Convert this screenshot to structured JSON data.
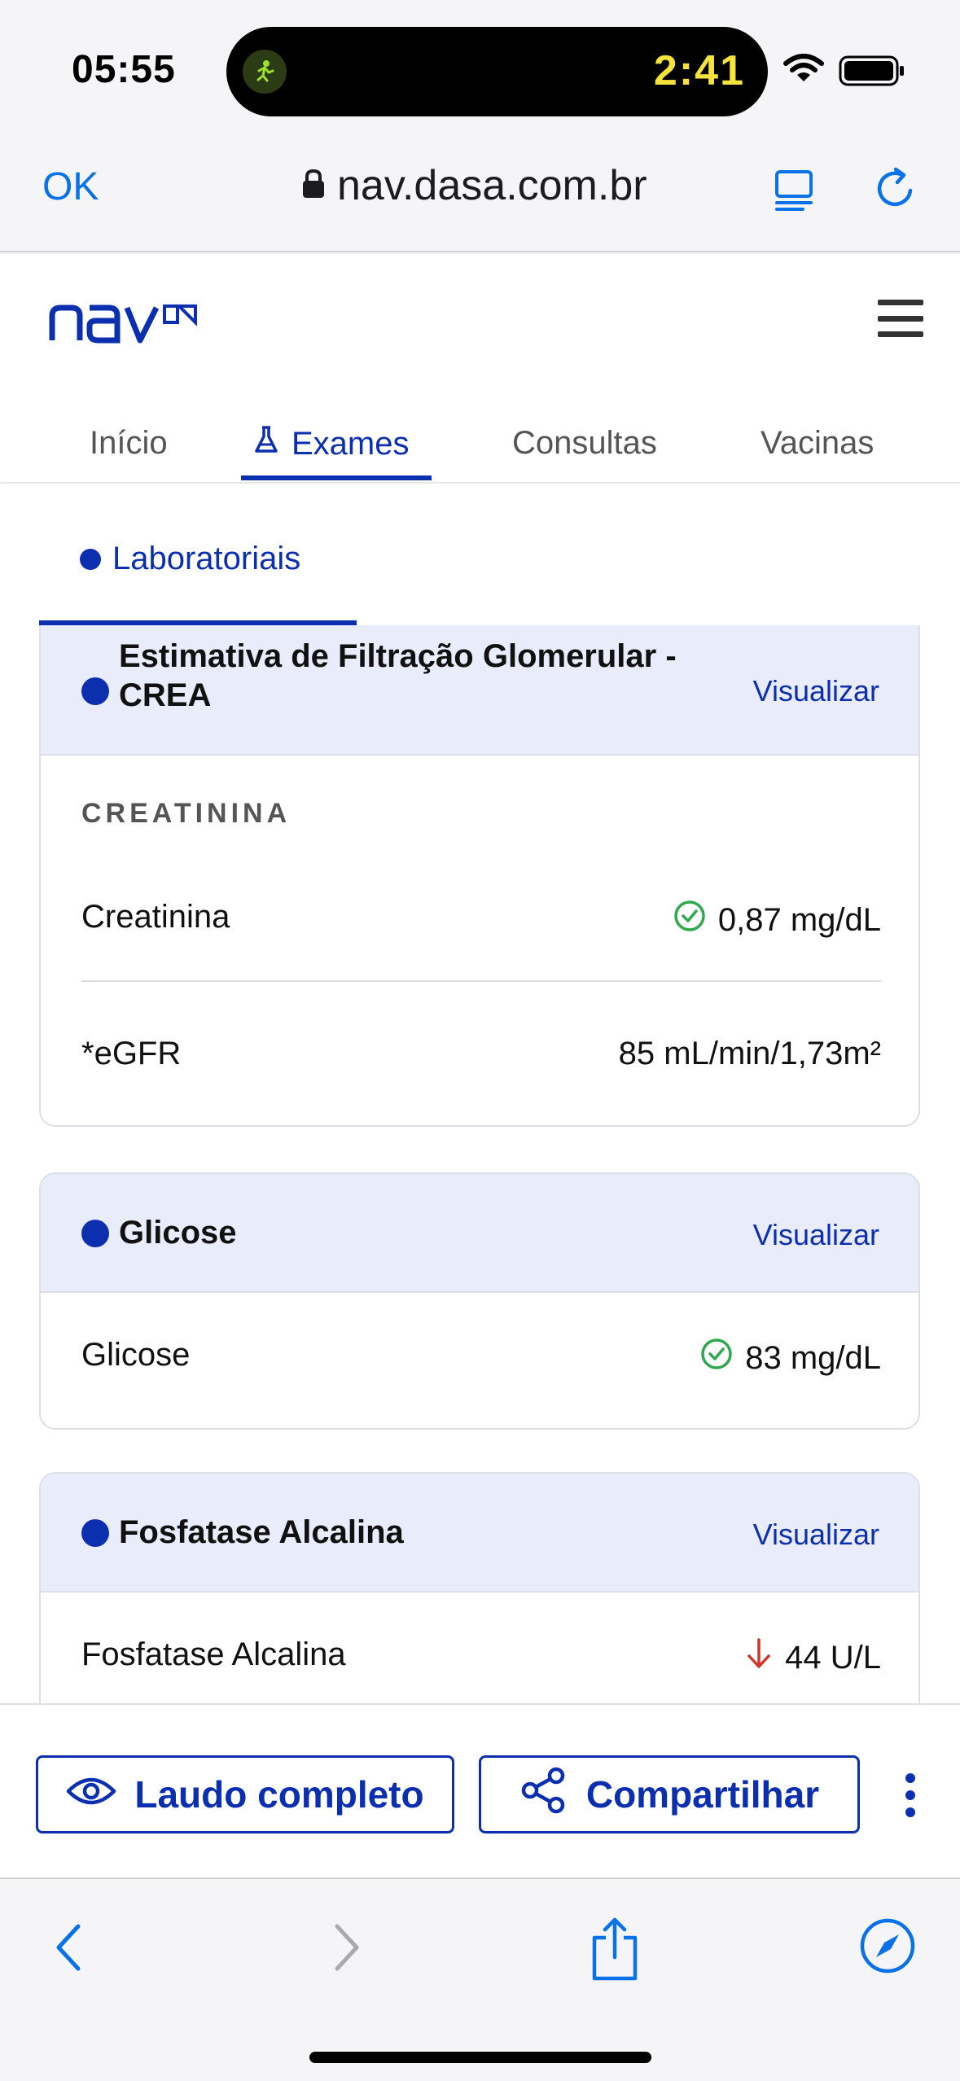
{
  "status_bar": {
    "time": "05:55",
    "timer": "2:41",
    "icons": [
      "activity-icon",
      "wifi-icon",
      "battery-icon"
    ]
  },
  "address_bar": {
    "done_label": "OK",
    "url": "nav.dasa.com.br",
    "icons": [
      "lock-icon",
      "reader-icon",
      "reload-icon"
    ]
  },
  "header": {
    "logo_alt": "nav dasa",
    "menu_icon": "hamburger-icon",
    "tabs": [
      {
        "label": "Início",
        "active": false
      },
      {
        "label": "Exames",
        "active": true,
        "icon": "flask-icon"
      },
      {
        "label": "Consultas",
        "active": false
      },
      {
        "label": "Vacinas",
        "active": false
      }
    ]
  },
  "subtabs": [
    {
      "label": "Laboratoriais",
      "active": true
    }
  ],
  "exams": [
    {
      "title": "Estimativa de Filtração Glomerular - CREA",
      "title_line1": "Estimativa de Filtração Glomerular -",
      "title_line2": "CREA",
      "link": "Visualizar",
      "section": "CREATININA",
      "results": [
        {
          "name": "Creatinina",
          "value": "0,87 mg/dL",
          "status": "normal"
        },
        {
          "name": "*eGFR",
          "value": "85 mL/min/1,73m²",
          "status": "none"
        }
      ]
    },
    {
      "title": "Glicose",
      "link": "Visualizar",
      "results": [
        {
          "name": "Glicose",
          "value": "83 mg/dL",
          "status": "normal"
        }
      ]
    },
    {
      "title": "Fosfatase Alcalina",
      "link": "Visualizar",
      "results": [
        {
          "name": "Fosfatase Alcalina",
          "value": "44 U/L",
          "status": "low"
        }
      ]
    }
  ],
  "actions": {
    "report_label": "Laudo completo",
    "share_label": "Compartilhar"
  },
  "colors": {
    "brand_blue": "#0c2fb0",
    "safari_blue": "#0a72e8",
    "normal_green": "#2fa84f",
    "low_red": "#d0342c",
    "header_bg": "#e9ecfb"
  }
}
